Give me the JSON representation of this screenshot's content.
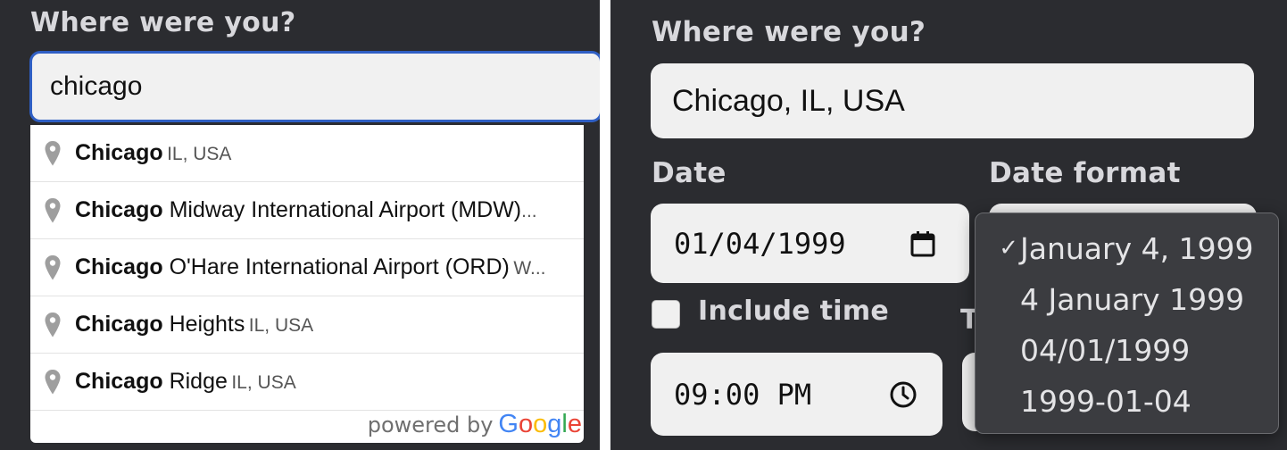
{
  "left": {
    "heading": "Where were you?",
    "search": {
      "value": "chicago"
    },
    "suggestions": [
      {
        "main": "Chicago",
        "rest": "",
        "secondary": "IL, USA"
      },
      {
        "main": "Chicago",
        "rest": " Midway International Airport (MDW)",
        "secondary": "..."
      },
      {
        "main": "Chicago",
        "rest": " O'Hare International Airport (ORD)",
        "secondary": "W..."
      },
      {
        "main": "Chicago",
        "rest": " Heights",
        "secondary": "IL, USA"
      },
      {
        "main": "Chicago",
        "rest": " Ridge",
        "secondary": "IL, USA"
      }
    ],
    "powered_by": {
      "text": "powered by",
      "brand": "Google"
    },
    "icons": {
      "pin": "map-pin-icon"
    },
    "colors": {
      "focus_border": "#2f5fc4",
      "google_blue": "#4285F4",
      "google_red": "#EA4335",
      "google_yellow": "#FBBC05",
      "google_green": "#34A853"
    }
  },
  "right": {
    "heading": "Where were you?",
    "location_value": "Chicago, IL, USA",
    "date_label": "Date",
    "date_value": "01/04/1999",
    "format_label": "Date format",
    "include_time_label": "Include time",
    "include_time_checked": false,
    "time_label_partial": "T",
    "time_value": "09:00 PM",
    "format_options": [
      {
        "label": "January 4, 1999",
        "selected": true,
        "check": "✓"
      },
      {
        "label": "4 January 1999",
        "selected": false,
        "check": ""
      },
      {
        "label": "04/01/1999",
        "selected": false,
        "check": ""
      },
      {
        "label": "1999-01-04",
        "selected": false,
        "check": ""
      }
    ],
    "icons": {
      "calendar": "calendar-icon",
      "clock": "clock-icon",
      "check": "checkmark-icon"
    }
  }
}
